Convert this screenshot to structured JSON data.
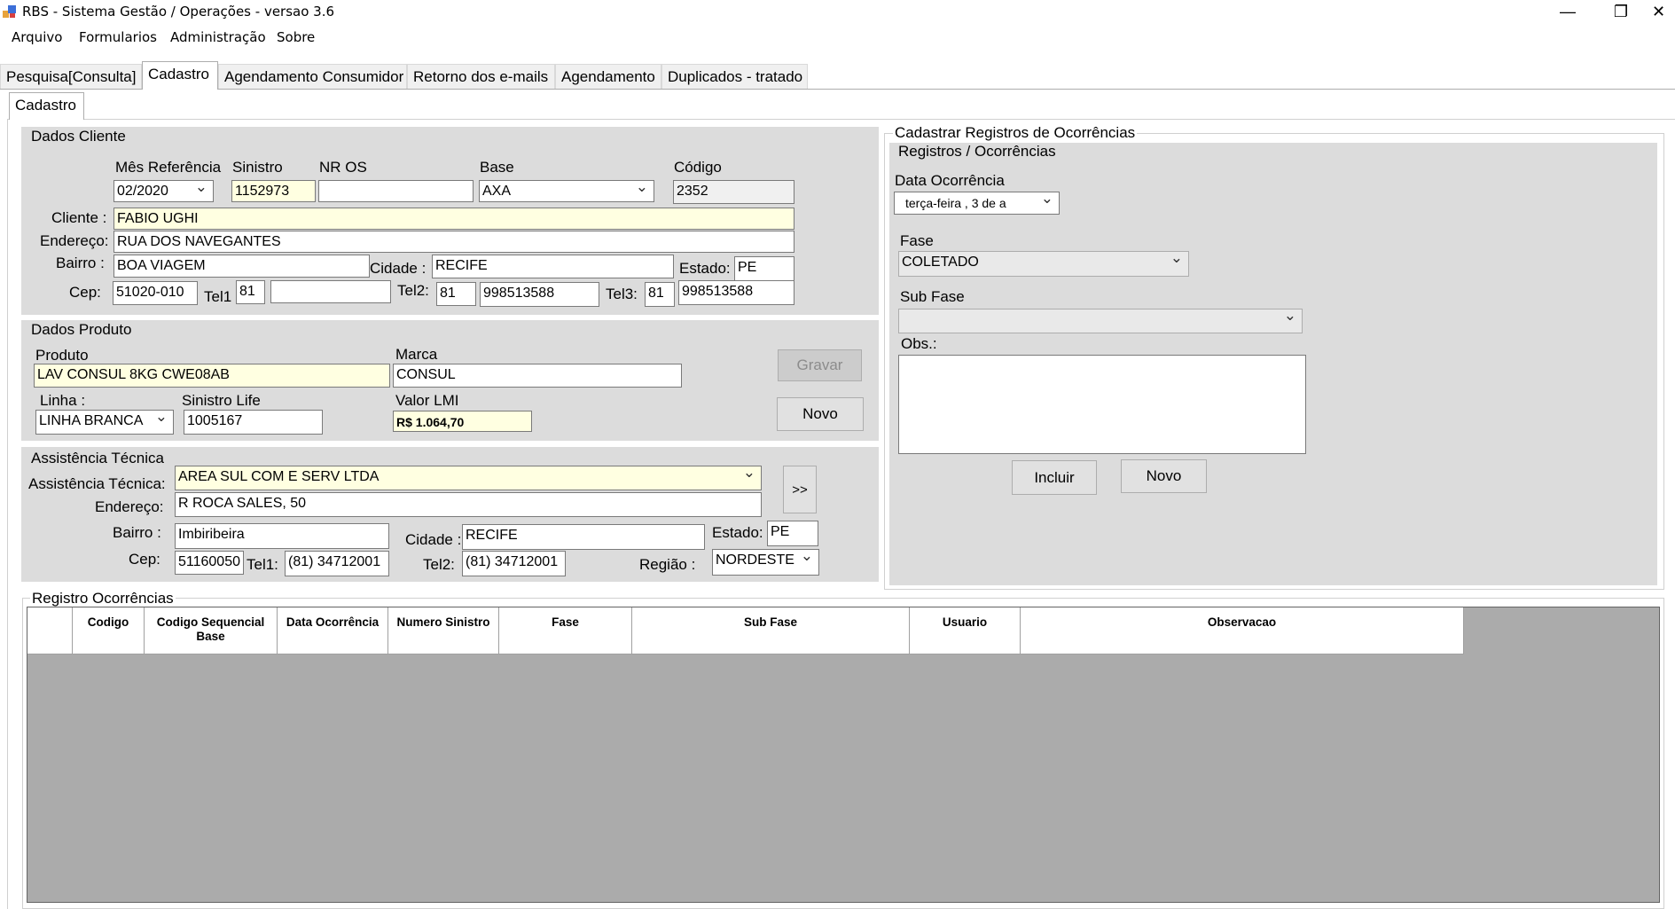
{
  "window": {
    "title": "RBS - Sistema Gestão / Operações - versao 3.6",
    "minimize": "—",
    "restore": "❐",
    "close": "✕"
  },
  "menu": [
    "Arquivo",
    "Formularios",
    "Administração",
    "Sobre"
  ],
  "tabs": [
    "Pesquisa[Consulta]",
    "Cadastro",
    "Agendamento Consumidor",
    "Retorno dos e-mails",
    "Agendamento",
    "Duplicados - tratado"
  ],
  "subtab": "Cadastro",
  "dados_cliente": {
    "title": "Dados Cliente",
    "labels": {
      "mes_ref": "Mês Referência",
      "sinistro": "Sinistro",
      "nr_os": "NR OS",
      "base": "Base",
      "codigo": "Código",
      "cliente": "Cliente :",
      "endereco": "Endereço:",
      "bairro": "Bairro :",
      "cidade": "Cidade :",
      "estado": "Estado:",
      "cep": "Cep:",
      "tel1": "Tel1",
      "tel2": "Tel2:",
      "tel3": "Tel3:"
    },
    "values": {
      "mes_ref": "02/2020",
      "sinistro": "1152973",
      "nr_os": "",
      "base": "AXA",
      "codigo": "2352",
      "cliente": "FABIO UGHI",
      "endereco": "RUA DOS NAVEGANTES",
      "bairro": "BOA VIAGEM",
      "cidade": "RECIFE",
      "estado": "PE",
      "cep": "51020-010",
      "tel1_ddd": "81",
      "tel1": "",
      "tel2_ddd": "81",
      "tel2": "998513588",
      "tel3_ddd": "81",
      "tel3": "998513588"
    }
  },
  "dados_produto": {
    "title": "Dados Produto",
    "labels": {
      "produto": "Produto",
      "marca": "Marca",
      "linha": "Linha :",
      "sinistro_life": "Sinistro Life",
      "valor_lmi": "Valor LMI"
    },
    "values": {
      "produto": "LAV CONSUL 8KG CWE08AB",
      "marca": "CONSUL",
      "linha": "LINHA BRANCA",
      "sinistro_life": "1005167",
      "valor_lmi": "R$ 1.064,70"
    },
    "buttons": {
      "gravar": "Gravar",
      "novo": "Novo"
    }
  },
  "assistencia": {
    "title": "Assistência Técnica",
    "labels": {
      "assistencia": "Assistência Técnica:",
      "endereco": "Endereço:",
      "bairro": "Bairro :",
      "cidade": "Cidade :",
      "estado": "Estado:",
      "cep": "Cep:",
      "tel1": "Tel1:",
      "tel2": "Tel2:",
      "regiao": "Região :"
    },
    "values": {
      "assistencia": "AREA SUL COM E SERV LTDA",
      "endereco": "R ROCA SALES, 50",
      "bairro": "Imbiribeira",
      "cidade": "RECIFE",
      "estado": "PE",
      "cep": "51160050",
      "tel1": "(81) 34712001",
      "tel2": "(81) 34712001",
      "regiao": "NORDESTE"
    },
    "more_button": ">>"
  },
  "ocorrencias": {
    "title": "Cadastrar Registros de Ocorrências",
    "subtitle": "Registros / Ocorrências",
    "labels": {
      "data": "Data Ocorrência",
      "fase": "Fase",
      "sub_fase": "Sub Fase",
      "obs": "Obs.:"
    },
    "values": {
      "data": "terça-feira  ,   3 de   a",
      "fase": "COLETADO",
      "sub_fase": "",
      "obs": ""
    },
    "buttons": {
      "incluir": "Incluir",
      "novo": "Novo"
    }
  },
  "registro": {
    "title": "Registro Ocorrências",
    "columns": [
      "Codigo",
      "Codigo Sequencial Base",
      "Data Ocorrência",
      "Numero Sinistro",
      "Fase",
      "Sub Fase",
      "Usuario",
      "Observacao"
    ]
  }
}
